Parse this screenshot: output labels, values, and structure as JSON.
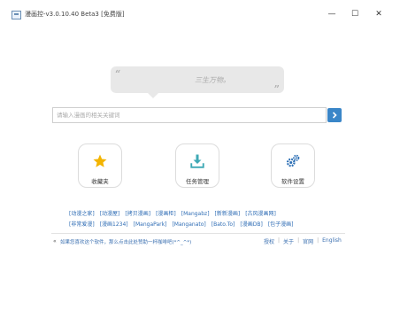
{
  "window": {
    "title": "漫画控-v3.0.10.40 Beta3 [免费版]",
    "minimize": "—",
    "maximize": "☐",
    "close": "✕"
  },
  "quote": {
    "text": "三生万物。",
    "open_mark": "“",
    "close_mark": "”"
  },
  "search": {
    "placeholder": "请输入漫画的相关关键词",
    "button_icon": "chevron-right-icon"
  },
  "cards": [
    {
      "label": "收藏夹",
      "icon": "star-icon",
      "color": "#f3b400"
    },
    {
      "label": "任务管理",
      "icon": "download-icon",
      "color": "#3fa9b5"
    },
    {
      "label": "软件设置",
      "icon": "gears-icon",
      "color": "#2c6fb5"
    }
  ],
  "links_row1": [
    "[动漫之家]",
    "[动漫屋]",
    "[拷贝漫画]",
    "[漫画柜]",
    "[Mangabz]",
    "[新新漫画]",
    "[古风漫画网]"
  ],
  "links_row2": [
    "[非常爱漫]",
    "[漫画1234]",
    "[MangaPark]",
    "[Manganato]",
    "[Bato.To]",
    "[漫画DB]",
    "[包子漫画]"
  ],
  "footer": {
    "arrow": "«",
    "message": "如果您喜欢这个软件，那么点击此处赞助一杯咖啡吧(*^_^*)",
    "links": [
      "授权",
      "关于",
      "官网",
      "English"
    ]
  },
  "colors": {
    "accent": "#3a86c8",
    "link": "#2f6db5"
  }
}
